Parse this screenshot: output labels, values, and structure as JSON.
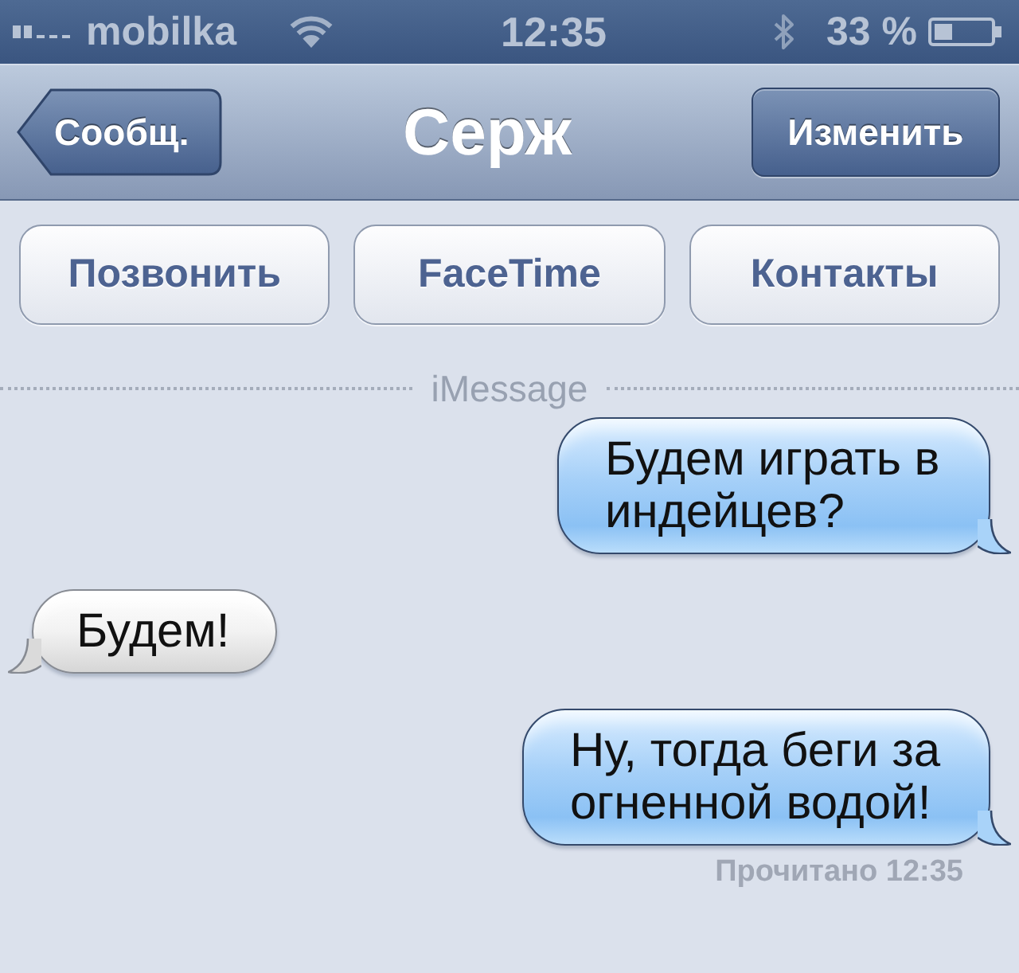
{
  "status_bar": {
    "carrier": "mobilka",
    "time": "12:35",
    "battery": "33 %"
  },
  "nav_bar": {
    "back_button": "Сообщ.",
    "title": "Серж",
    "edit_button": "Изменить"
  },
  "actions": [
    {
      "label": "Позвонить"
    },
    {
      "label": "FaceTime"
    },
    {
      "label": "Контакты"
    }
  ],
  "separator": "iMessage",
  "messages": [
    {
      "kind": "sent",
      "text": "Будем играть в индейцев?"
    },
    {
      "kind": "received",
      "text": "Будем!"
    },
    {
      "kind": "sent",
      "text": "Ну, тогда беги за огненной водой!"
    }
  ],
  "read_receipt": "Прочитано 12:35"
}
